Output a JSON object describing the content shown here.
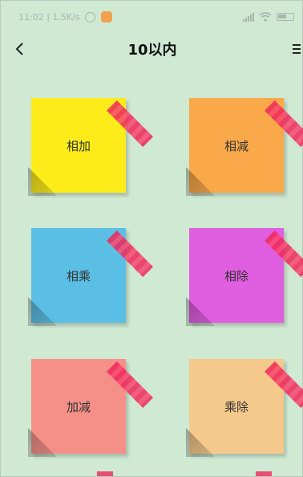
{
  "status_bar": {
    "time_speed": "11:02 | 1.5K/s"
  },
  "header": {
    "title": "10以内"
  },
  "notes": [
    {
      "label": "相加",
      "color": "#fdec1a"
    },
    {
      "label": "相减",
      "color": "#f9a84a"
    },
    {
      "label": "相乘",
      "color": "#5bbfe5"
    },
    {
      "label": "相除",
      "color": "#e05ee0"
    },
    {
      "label": "加减",
      "color": "#f59089"
    },
    {
      "label": "乘除",
      "color": "#f5c98c"
    }
  ],
  "icons": [
    "back-icon",
    "menu-icon",
    "alarm-icon",
    "signal-icon",
    "wifi-icon",
    "battery-icon"
  ]
}
